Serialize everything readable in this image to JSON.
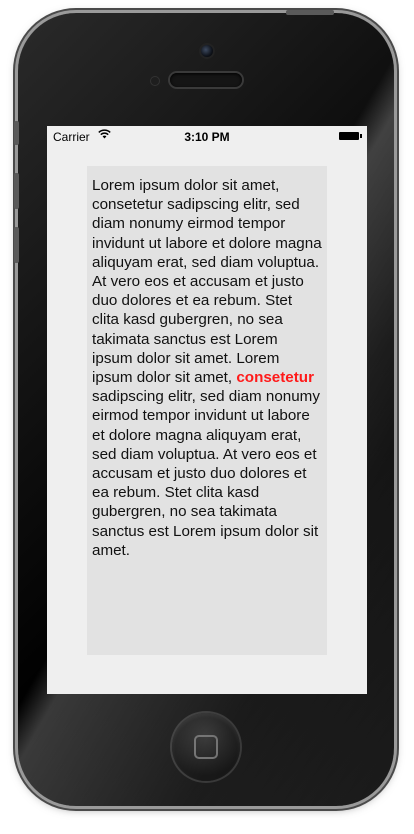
{
  "status_bar": {
    "carrier": "Carrier",
    "wifi_icon": "wifi-icon",
    "time": "3:10 PM",
    "battery_icon": "battery-icon"
  },
  "content": {
    "text_before": "Lorem ipsum dolor sit amet, consetetur sadipscing elitr, sed diam nonumy eirmod tempor invidunt ut labore et dolore magna aliquyam erat, sed diam voluptua. At vero eos et accusam et justo duo dolores et ea rebum. Stet clita kasd gubergren, no sea takimata sanctus est Lorem ipsum dolor sit amet. Lorem ipsum dolor sit amet, ",
    "highlight": "consetetur",
    "text_after": " sadipscing elitr, sed diam nonumy eirmod tempor invidunt ut labore et dolore magna aliquyam erat, sed diam voluptua. At vero eos et accusam et justo duo dolores et ea rebum. Stet clita kasd gubergren, no sea takimata sanctus est Lorem ipsum dolor sit amet.",
    "highlight_color": "#ff1a1a"
  }
}
